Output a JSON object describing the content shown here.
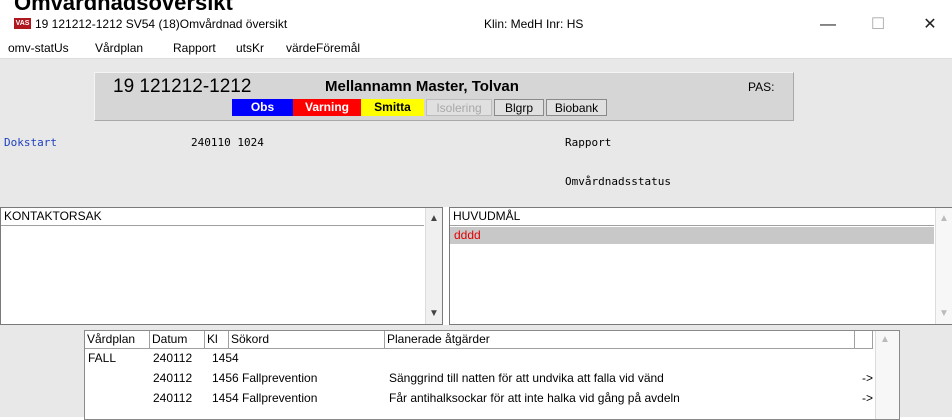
{
  "page_heading": "Omvårdnadsöversikt",
  "window": {
    "icon_text": "VAS",
    "title": "19 121212-1212  SV54 (18)Omvårdnad översikt",
    "klin": "Klin: MedH  Inr: HS",
    "minimize": "—",
    "maximize": "☐",
    "close": "✕"
  },
  "menu": [
    "omv-statUs",
    "Vårdplan",
    "Rapport",
    "utsKr",
    "värdeFöremål"
  ],
  "patient": {
    "pnr": "19 121212-1212",
    "name": "Mellannamn Master, Tolvan",
    "pas": "PAS:"
  },
  "flags": [
    {
      "label": "Obs",
      "bg": "#0000ff",
      "fg": "#ffffff"
    },
    {
      "label": "Varning",
      "bg": "#ff0000",
      "fg": "#ffffff"
    },
    {
      "label": "Smitta",
      "bg": "#ffff00",
      "fg": "#000000"
    },
    {
      "label": "Isolering",
      "bg": "#e0e0e0",
      "fg": "#a8a8a8"
    },
    {
      "label": "Blgrp",
      "bg": "#e0e0e0",
      "fg": "#000000"
    },
    {
      "label": "Biobank",
      "bg": "#e0e0e0",
      "fg": "#000000"
    }
  ],
  "doc": {
    "dokstart_label": "Dokstart",
    "dokstart_value": "240110 1024",
    "rapport": "Rapport",
    "omvardnadsstatus": "Omvårdnadsstatus"
  },
  "kontaktorsak": {
    "header": "KONTAKTORSAK",
    "items": []
  },
  "huvudmal": {
    "header": "HUVUDMÅL",
    "items": [
      "dddd"
    ]
  },
  "careplan_table": {
    "columns": [
      "Vårdplan",
      "Datum",
      "Kl",
      "Sökord",
      "Planerade åtgärder"
    ],
    "rows": [
      {
        "vardplan": "FALL",
        "datum": "240112",
        "kl": "1454",
        "sokord": "",
        "atgard": "",
        "arrow": ""
      },
      {
        "vardplan": "",
        "datum": "240112",
        "kl": "1456",
        "sokord": "Fallprevention",
        "atgard": "Sänggrind till natten för att undvika att falla vid vänd",
        "arrow": "->"
      },
      {
        "vardplan": "",
        "datum": "240112",
        "kl": "1454",
        "sokord": "Fallprevention",
        "atgard": "Får antihalksockar för att inte halka vid gång på avdeln",
        "arrow": "->"
      }
    ]
  },
  "colors": {
    "accent_link": "#1f3fbf",
    "selected_row": "#c8c8c8",
    "selected_text": "#e00000"
  }
}
